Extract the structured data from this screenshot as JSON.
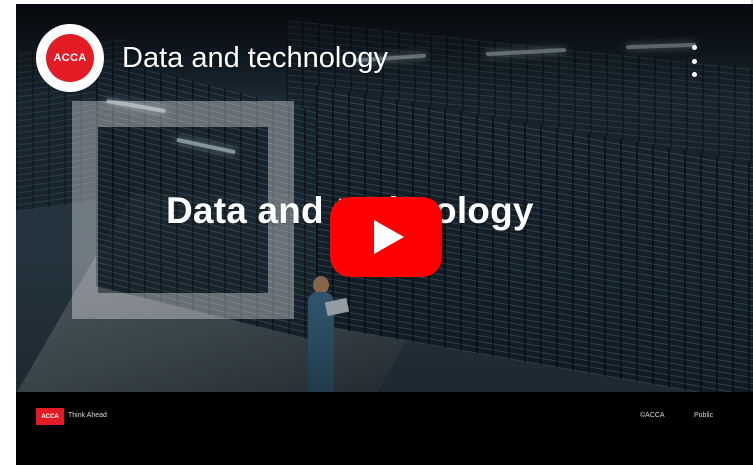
{
  "video": {
    "title": "Data and technology",
    "title_card_text": "Data and technology",
    "channel_logo_text": "ACCA"
  },
  "icons": {
    "menu": "more-vert-icon",
    "play": "play-icon"
  },
  "footer": {
    "logo_text": "ACCA",
    "tagline": "Think Ahead",
    "copyright": "©ACCA",
    "visibility": "Public"
  },
  "colors": {
    "brand_red": "#e21b24",
    "play_red": "#ff0000"
  }
}
